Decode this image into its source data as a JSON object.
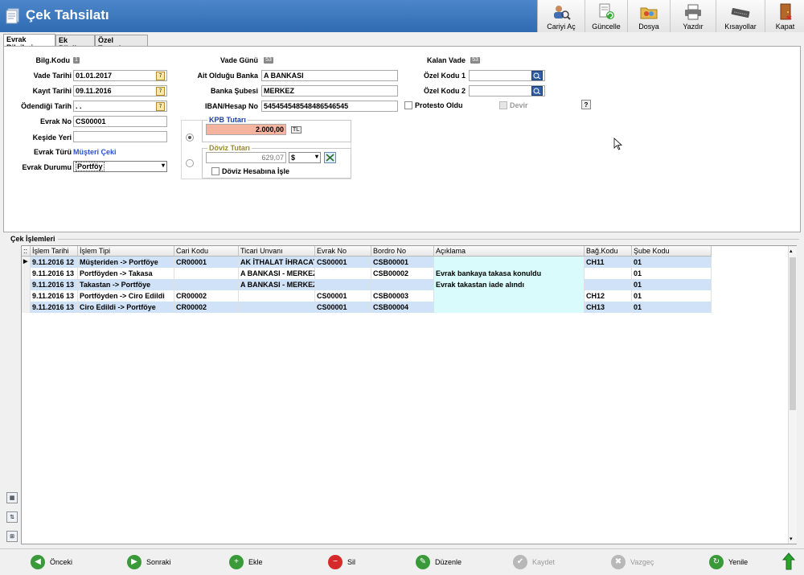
{
  "window": {
    "title": "Çek Tahsilatı"
  },
  "toolbar": [
    {
      "label": "Cariyi Aç",
      "icon": "user-search-icon"
    },
    {
      "label": "Güncelle",
      "icon": "refresh-document-icon"
    },
    {
      "label": "Dosya",
      "icon": "folder-icon"
    },
    {
      "label": "Yazdır",
      "icon": "printer-icon"
    },
    {
      "label": "Kısayollar",
      "icon": "keyboard-icon"
    },
    {
      "label": "Kapat",
      "icon": "exit-door-icon"
    }
  ],
  "tabs": [
    "Evrak Bilgileri",
    "Ek Bilgiler",
    "Özel Tanımlar"
  ],
  "form": {
    "bilg_kodu_label": "Bilg.Kodu",
    "bilg_kodu_value": "1",
    "vade_tarihi_label": "Vade Tarihi",
    "vade_tarihi": "01.01.2017",
    "kayit_tarihi_label": "Kayıt Tarihi",
    "kayit_tarihi": "09.11.2016",
    "odendigi_tarih_label": "Ödendiği Tarih",
    "odendigi_tarih": " . .",
    "evrak_no_label": "Evrak No",
    "evrak_no": "CS00001",
    "keside_yeri_label": "Keşide Yeri",
    "keside_yeri": "",
    "evrak_turu_label": "Evrak Türü",
    "evrak_turu": "Müşteri Çeki",
    "evrak_durumu_label": "Evrak Durumu",
    "evrak_durumu": "Portföy",
    "vade_gunu_label": "Vade Günü",
    "vade_gunu_value": "53",
    "ait_banka_label": "Ait Olduğu Banka",
    "ait_banka": "A BANKASI",
    "banka_subesi_label": "Banka Şubesi",
    "banka_subesi": "MERKEZ",
    "iban_label": "IBAN/Hesap No",
    "iban": "545454548548486546545",
    "kalan_vade_label": "Kalan Vade",
    "kalan_vade_value": "53",
    "ozel_kodu1_label": "Özel Kodu 1",
    "ozel_kodu1": "",
    "ozel_kodu2_label": "Özel Kodu 2",
    "ozel_kodu2": "",
    "protesto_label": "Protesto Oldu",
    "devir_label": "Devir",
    "help_label": "?",
    "kpb_title": "KPB Tutarı",
    "kpb_amount": "2.000,00",
    "kpb_currency": "TL",
    "doviz_title": "Döviz Tutarı",
    "doviz_amount": "629,07",
    "doviz_currency": "$",
    "doviz_hesap_label": "Döviz Hesabına İşle"
  },
  "section": {
    "cek_islemleri": "Çek İşlemleri"
  },
  "grid": {
    "columns": [
      "İşlem Tarihi",
      "İşlem Tipi",
      "Cari Kodu",
      "Ticari Unvanı",
      "Evrak No",
      "Bordro No",
      "Açıklama",
      "Bağ.Kodu",
      "Şube Kodu"
    ],
    "rows": [
      [
        "9.11.2016 12",
        "Müşteriden -> Portföye",
        "CR00001",
        "AK İTHALAT İHRACAT",
        "CS00001",
        "CSB00001",
        "",
        "CH11",
        "01"
      ],
      [
        "9.11.2016 13",
        "Portföyden -> Takasa",
        "",
        "A BANKASI - MERKEZ",
        "",
        "CSB00002",
        "Evrak bankaya takasa konuldu",
        "",
        "01"
      ],
      [
        "9.11.2016 13",
        "Takastan -> Portföye",
        "",
        "A BANKASI - MERKEZ",
        "",
        "",
        "Evrak takastan iade alındı",
        "",
        "01"
      ],
      [
        "9.11.2016 13",
        "Portföyden -> Ciro Edildi",
        "CR00002",
        "",
        "CS00001",
        "CSB00003",
        "",
        "CH12",
        "01"
      ],
      [
        "9.11.2016 13",
        "Ciro Edildi -> Portföye",
        "CR00002",
        "",
        "CS00001",
        "CSB00004",
        "",
        "CH13",
        "01"
      ]
    ]
  },
  "bottom": [
    {
      "label": "Önceki",
      "color": "#3a9a3a"
    },
    {
      "label": "Sonraki",
      "color": "#3a9a3a"
    },
    {
      "label": "Ekle",
      "color": "#3a9a3a"
    },
    {
      "label": "Sil",
      "color": "#d62a2a"
    },
    {
      "label": "Düzenle",
      "color": "#3a9a3a"
    },
    {
      "label": "Kaydet",
      "color": "#b8b8b8"
    },
    {
      "label": "Vazgeç",
      "color": "#b8b8b8"
    },
    {
      "label": "Yenile",
      "color": "#3a9a3a"
    }
  ]
}
